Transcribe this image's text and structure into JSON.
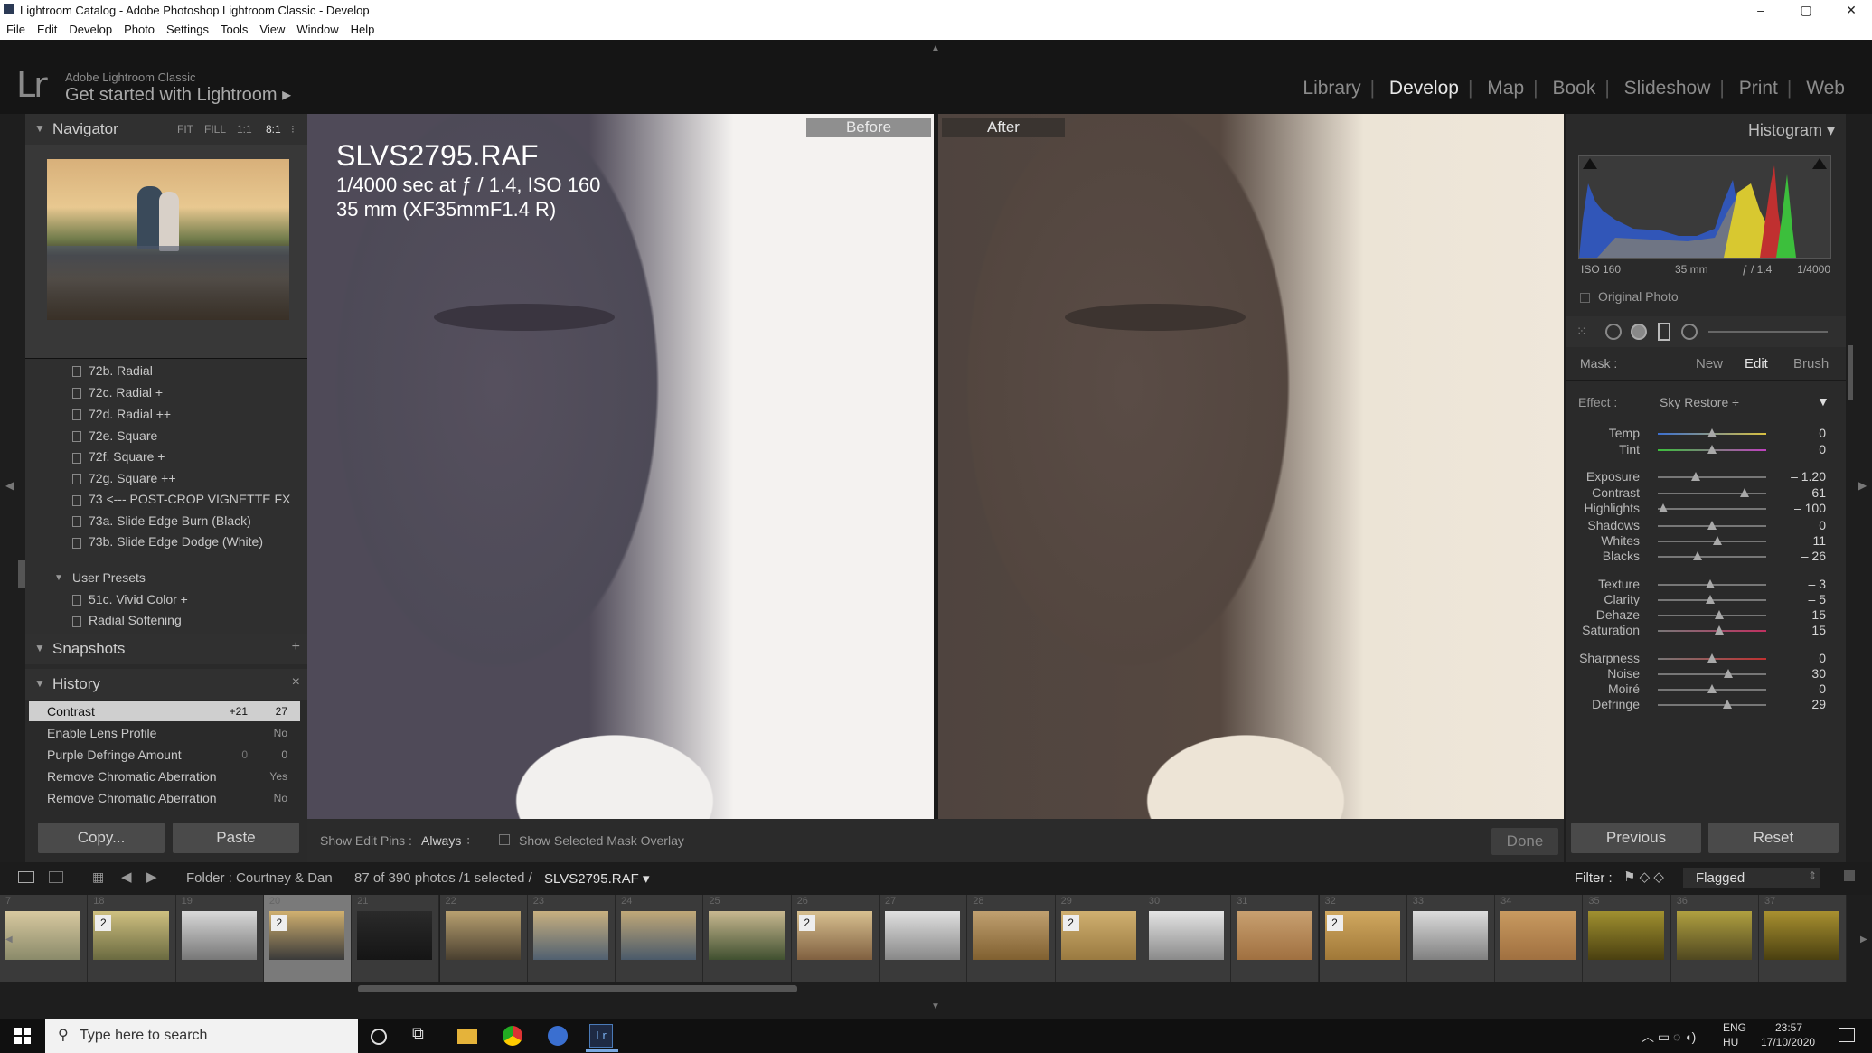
{
  "window": {
    "title": "Lightroom Catalog - Adobe Photoshop Lightroom Classic - Develop",
    "controls": [
      "–",
      "▢",
      "✕"
    ]
  },
  "menu": [
    "File",
    "Edit",
    "Develop",
    "Photo",
    "Settings",
    "Tools",
    "View",
    "Window",
    "Help"
  ],
  "identity": {
    "logo": "Lr",
    "brand_small": "Adobe Lightroom Classic",
    "brand_big": "Get started with Lightroom ▸"
  },
  "modules": [
    "Library",
    "Develop",
    "Map",
    "Book",
    "Slideshow",
    "Print",
    "Web"
  ],
  "active_module": "Develop",
  "navigator": {
    "title": "Navigator",
    "zoom": [
      "FIT",
      "FILL",
      "1:1",
      "8:1"
    ],
    "active_zoom": "8:1"
  },
  "presets": {
    "items": [
      "72b. Radial",
      "72c. Radial +",
      "72d. Radial ++",
      "72e. Square",
      "72f. Square +",
      "72g. Square ++",
      "73 <--- POST-CROP VIGNETTE FX",
      "73a. Slide Edge Burn (Black)",
      "73b. Slide Edge Dodge (White)"
    ],
    "group": "User Presets",
    "user_items": [
      "51c. Vivid Color +",
      "Radial Softening"
    ]
  },
  "snapshots": {
    "title": "Snapshots",
    "add": "+"
  },
  "history": {
    "title": "History",
    "close": "×",
    "rows": [
      {
        "name": "Contrast",
        "a": "+21",
        "b": "27"
      },
      {
        "name": "Enable Lens Profile",
        "a": "",
        "b": "No"
      },
      {
        "name": "Purple Defringe Amount",
        "a": "0",
        "b": "0"
      },
      {
        "name": "Remove Chromatic Aberration",
        "a": "",
        "b": "Yes"
      },
      {
        "name": "Remove Chromatic Aberration",
        "a": "",
        "b": "No"
      }
    ]
  },
  "left_buttons": {
    "copy": "Copy...",
    "paste": "Paste"
  },
  "photo_info": {
    "filename": "SLVS2795.RAF",
    "exposure": "1/4000 sec at ƒ / 1.4, ISO 160",
    "lens": "35 mm (XF35mmF1.4 R)"
  },
  "before_label": "Before",
  "after_label": "After",
  "toolbar": {
    "pins_label": "Show Edit Pins :",
    "pins_value": "Always ÷",
    "overlay_label": "Show Selected Mask Overlay",
    "done": "Done"
  },
  "histogram": {
    "title": "Histogram ▾",
    "iso": "ISO 160",
    "focal": "35 mm",
    "aperture": "ƒ / 1.4",
    "shutter": "1/4000",
    "original": "Original Photo"
  },
  "mask": {
    "label": "Mask :",
    "new": "New",
    "edit": "Edit",
    "brush": "Brush"
  },
  "effect": {
    "label": "Effect :",
    "value": "Sky Restore ÷"
  },
  "sliders": [
    {
      "label": "Temp",
      "value": "0",
      "pos": 0.5
    },
    {
      "label": "Tint",
      "value": "0",
      "pos": 0.5
    },
    {
      "label": "Exposure",
      "value": "– 1.20",
      "pos": 0.35
    },
    {
      "label": "Contrast",
      "value": "61",
      "pos": 0.8
    },
    {
      "label": "Highlights",
      "value": "– 100",
      "pos": 0.05
    },
    {
      "label": "Shadows",
      "value": "0",
      "pos": 0.5
    },
    {
      "label": "Whites",
      "value": "11",
      "pos": 0.55
    },
    {
      "label": "Blacks",
      "value": "– 26",
      "pos": 0.37
    },
    {
      "label": "Texture",
      "value": "– 3",
      "pos": 0.48
    },
    {
      "label": "Clarity",
      "value": "– 5",
      "pos": 0.48
    },
    {
      "label": "Dehaze",
      "value": "15",
      "pos": 0.57
    },
    {
      "label": "Saturation",
      "value": "15",
      "pos": 0.57
    },
    {
      "label": "Sharpness",
      "value": "0",
      "pos": 0.5
    },
    {
      "label": "Noise",
      "value": "30",
      "pos": 0.65
    },
    {
      "label": "Moiré",
      "value": "0",
      "pos": 0.5
    },
    {
      "label": "Defringe",
      "value": "29",
      "pos": 0.64
    }
  ],
  "right_buttons": {
    "previous": "Previous",
    "reset": "Reset"
  },
  "filmbar": {
    "folder": "Folder : Courtney & Dan",
    "count": "87 of 390 photos /1 selected /",
    "file": "SLVS2795.RAF ▾",
    "filter_label": "Filter :",
    "filter_value": "Flagged"
  },
  "filmstrip": [
    {
      "num": "7",
      "badge": ""
    },
    {
      "num": "18",
      "badge": "2"
    },
    {
      "num": "19",
      "badge": ""
    },
    {
      "num": "20",
      "badge": "2",
      "selected": true
    },
    {
      "num": "21",
      "badge": ""
    },
    {
      "num": "22",
      "badge": ""
    },
    {
      "num": "23",
      "badge": ""
    },
    {
      "num": "24",
      "badge": ""
    },
    {
      "num": "25",
      "badge": ""
    },
    {
      "num": "26",
      "badge": "2"
    },
    {
      "num": "27",
      "badge": ""
    },
    {
      "num": "28",
      "badge": ""
    },
    {
      "num": "29",
      "badge": "2"
    },
    {
      "num": "30",
      "badge": ""
    },
    {
      "num": "31",
      "badge": ""
    },
    {
      "num": "32",
      "badge": "2"
    },
    {
      "num": "33",
      "badge": ""
    },
    {
      "num": "34",
      "badge": ""
    },
    {
      "num": "35",
      "badge": ""
    },
    {
      "num": "36",
      "badge": ""
    },
    {
      "num": "37",
      "badge": ""
    }
  ],
  "taskbar": {
    "search_placeholder": "Type here to search",
    "lang1": "ENG",
    "lang2": "HU",
    "time": "23:57",
    "date": "17/10/2020"
  }
}
